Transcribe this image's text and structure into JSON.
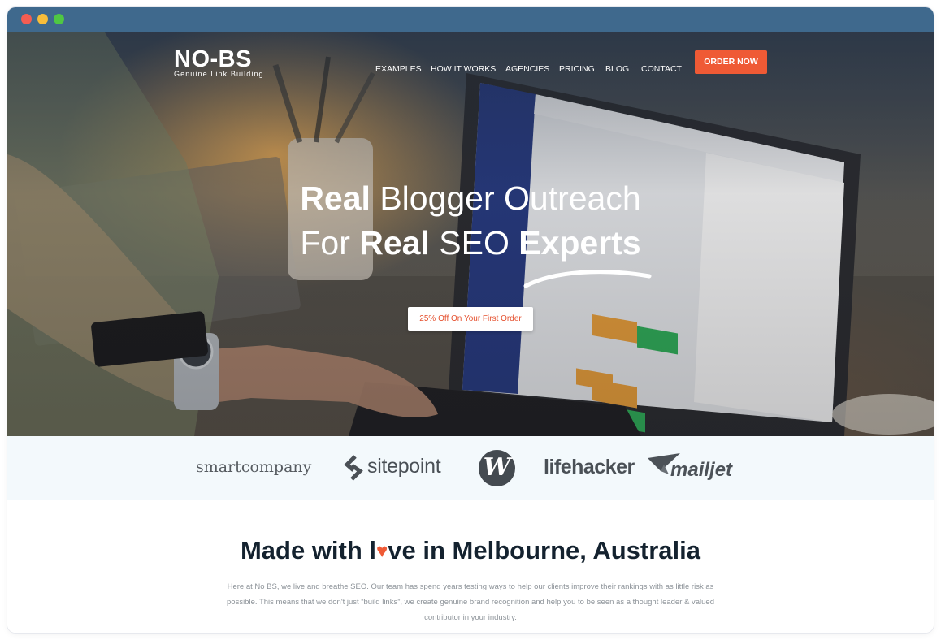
{
  "window": {
    "controls": {
      "close": "close-dot",
      "minimize": "minimize-dot",
      "maximize": "maximize-dot"
    }
  },
  "header": {
    "logo_text": "NO-BS",
    "logo_tagline": "Genuine Link Building",
    "nav": [
      "EXAMPLES",
      "HOW IT WORKS",
      "AGENCIES",
      "PRICING",
      "BLOG",
      "CONTACT"
    ],
    "cta_label": "ORDER NOW"
  },
  "hero": {
    "line1_bold": "Real",
    "line1_rest": " Blogger Outreach",
    "line2_a": "For ",
    "line2_bold1": "Real",
    "line2_b": " SEO ",
    "line2_bold2": "Experts",
    "promo_label": "25% Off On Your First Order"
  },
  "press_logos": {
    "smartcompany": "smartcompany",
    "sitepoint": "sitepoint",
    "w_mark": "W",
    "lifehacker": "lifehacker",
    "mailjet": "mailjet"
  },
  "about": {
    "title_before": "Made with l",
    "title_heart": "♥",
    "title_after": "ve in Melbourne, Australia",
    "body": "Here at No BS, we live and breathe SEO. Our team has spend years testing ways to help our clients improve their rankings with as little risk as possible. This means that we don't just “build links”, we create genuine brand recognition and help you to be seen as a thought leader & valued contributor in your industry."
  },
  "colors": {
    "accent": "#ef5a35",
    "titlebar": "#3f698d",
    "heading": "#14222f",
    "logos_bg": "#f3f9fc"
  }
}
